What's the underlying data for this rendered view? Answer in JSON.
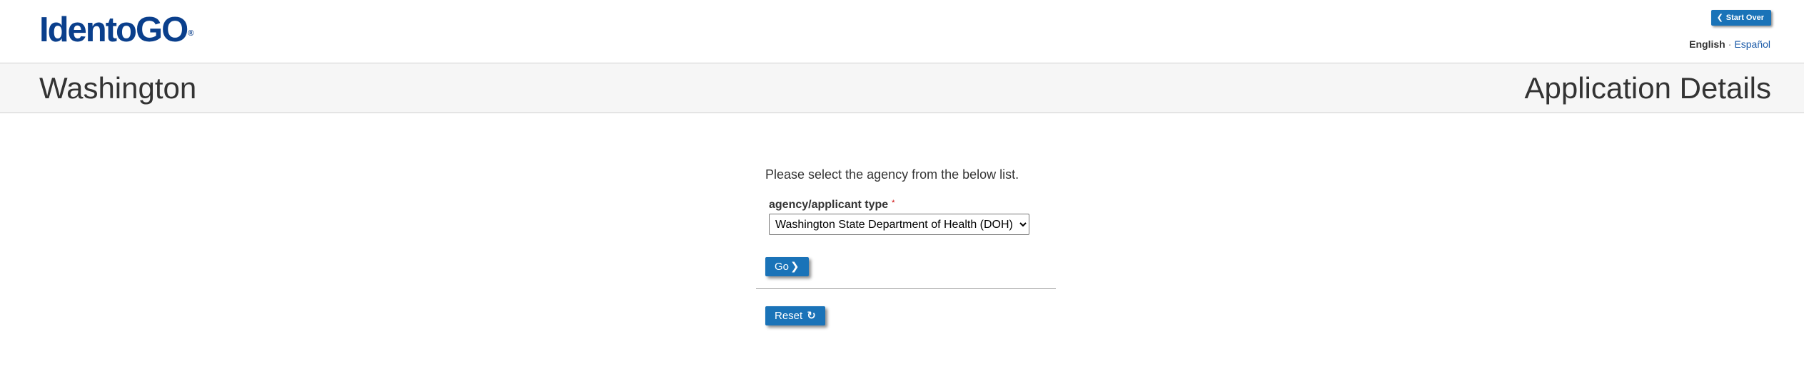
{
  "header": {
    "logo_text": "IdentoGO",
    "logo_mark": "®",
    "start_over_label": "Start Over",
    "start_over_icon": "chevron-left-icon",
    "language": {
      "current": "English",
      "separator": "·",
      "alternate": "Español"
    }
  },
  "subheader": {
    "state": "Washington",
    "section": "Application Details"
  },
  "form": {
    "instruction": "Please select the agency from the below list.",
    "field_label": "agency/applicant type",
    "required_marker": "*",
    "selected_agency": "Washington State Department of Health (DOH)",
    "go_label": "Go",
    "go_icon": "chevron-right-icon",
    "reset_label": "Reset",
    "reset_icon": "refresh-icon"
  },
  "colors": {
    "logo": "#0a3f8c",
    "button": "#1a73b8",
    "link": "#1a5aa8",
    "required": "#cc0000",
    "subbar_bg": "#f6f6f6"
  }
}
